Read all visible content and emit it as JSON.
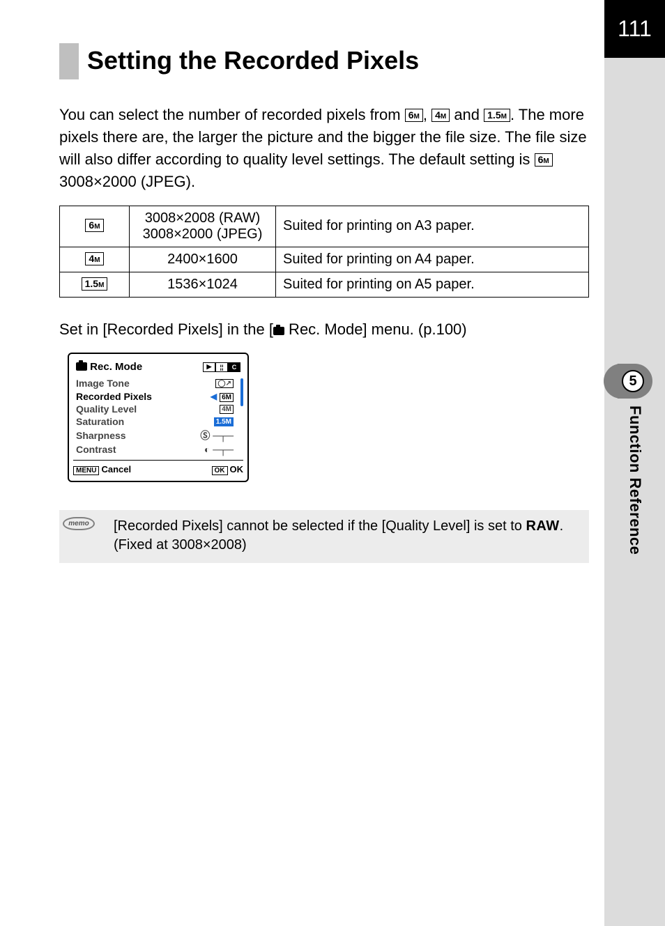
{
  "page_number": "111",
  "chapter_number": "5",
  "sidebar_label": "Function Reference",
  "heading": "Setting the Recorded Pixels",
  "intro_p1_a": "You can select the number of recorded pixels from ",
  "intro_p1_b": ", ",
  "intro_p1_c": " and ",
  "intro_p1_d": ". The more pixels there are, the larger the picture and the bigger the file size. The file size will also differ according to quality level settings. The default setting is ",
  "intro_p1_e": " 3008×2000 (JPEG).",
  "badges": {
    "six": "6",
    "four": "4",
    "onefive": "1.5",
    "m": "M"
  },
  "table": {
    "rows": [
      {
        "badge": "6",
        "res_a": "3008×2008 (RAW)",
        "res_b": "3008×2000 (JPEG)",
        "desc": "Suited for printing on A3 paper."
      },
      {
        "badge": "4",
        "res_a": "2400×1600",
        "res_b": "",
        "desc": "Suited for printing on A4 paper."
      },
      {
        "badge": "1.5",
        "res_a": "1536×1024",
        "res_b": "",
        "desc": "Suited for printing on A5 paper."
      }
    ]
  },
  "set_in_a": "Set in [Recorded Pixels] in the [",
  "set_in_b": " Rec. Mode] menu. (p.100)",
  "menu": {
    "title": "Rec. Mode",
    "items": {
      "image_tone": "Image Tone",
      "recorded_pixels": "Recorded Pixels",
      "quality_level": "Quality Level",
      "saturation": "Saturation",
      "sharpness": "Sharpness",
      "contrast": "Contrast"
    },
    "cancel": "Cancel",
    "menu_btn": "MENU",
    "ok_btn": "OK",
    "ok_label": "OK"
  },
  "memo": {
    "icon_text": "memo",
    "text_a": "[Recorded Pixels] cannot be selected if the [Quality Level] is set to ",
    "raw": "RAW",
    "text_b": ". (Fixed at 3008×2008)"
  }
}
